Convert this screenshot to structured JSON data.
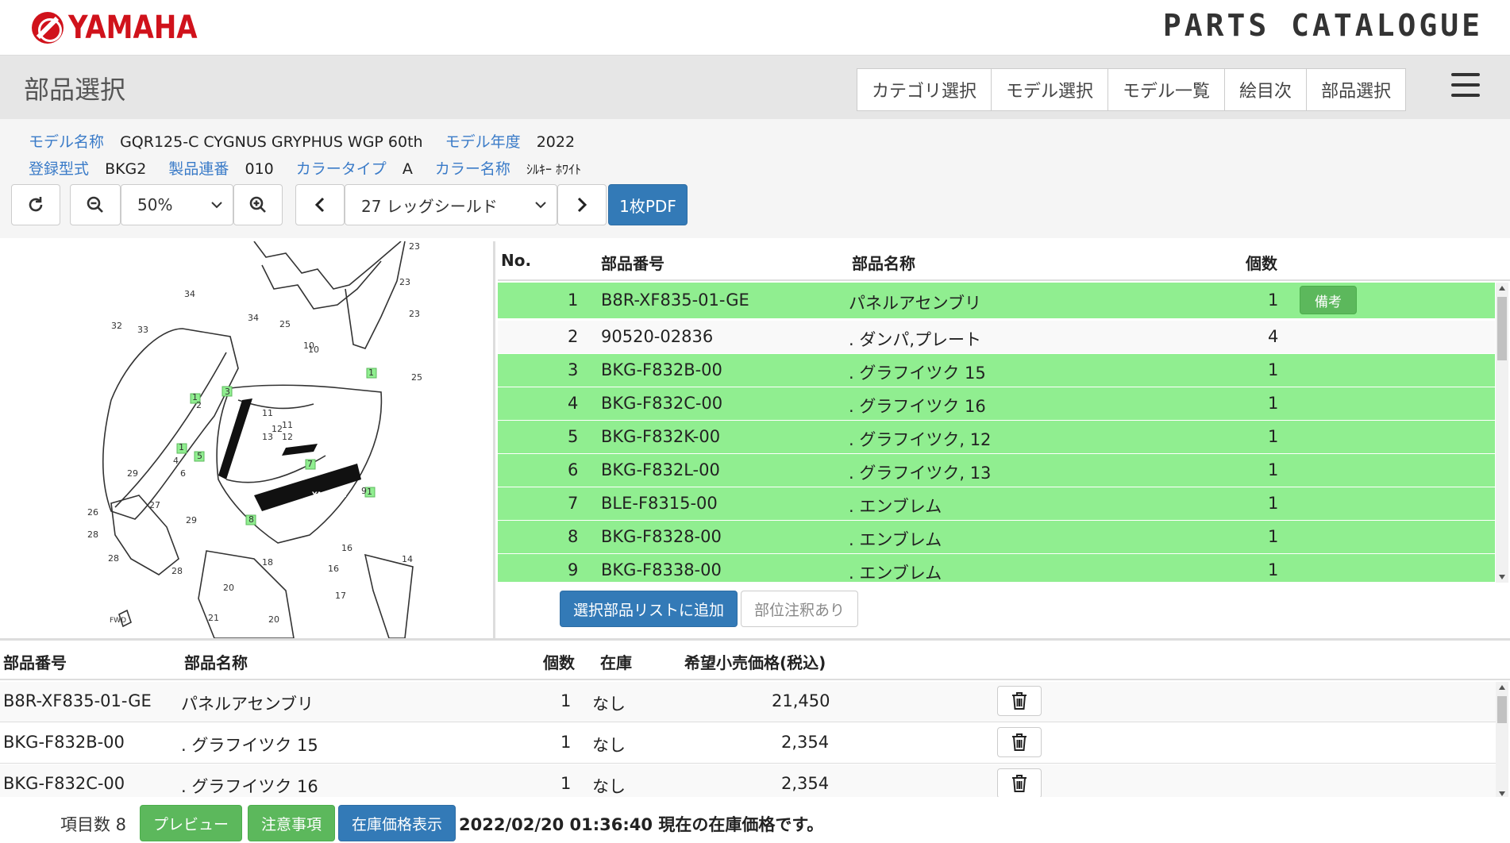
{
  "brand": {
    "logo_text": "YAMAHA",
    "catalogue_text": "PARTS CATALOGUE"
  },
  "header": {
    "title": "部品選択",
    "tabs": [
      "カテゴリ選択",
      "モデル選択",
      "モデル一覧",
      "絵目次",
      "部品選択"
    ]
  },
  "info": {
    "model_name_label": "モデル名称",
    "model_name": "GQR125-C CYGNUS GRYPHUS WGP 60th",
    "model_year_label": "モデル年度",
    "model_year": "2022",
    "reg_type_label": "登録型式",
    "reg_type": "BKG2",
    "serial_label": "製品連番",
    "serial": "010",
    "color_type_label": "カラータイプ",
    "color_type": "A",
    "color_name_label": "カラー名称",
    "color_name": "ｼﾙｷｰ ﾎﾜｲﾄ"
  },
  "toolbar": {
    "zoom_value": "50%",
    "page_select": "27 レッグシールド",
    "pdf_label": "1枚PDF"
  },
  "parts_table": {
    "headers": {
      "no": "No.",
      "part_number": "部品番号",
      "part_name": "部品名称",
      "qty": "個数"
    },
    "rows": [
      {
        "no": "1",
        "part_number": "B8R-XF835-01-GE",
        "part_name": "パネルアセンブリ",
        "qty": "1",
        "note": "備考"
      },
      {
        "no": "2",
        "part_number": "90520-02836",
        "part_name": ". ダンパ,プレート",
        "qty": "4"
      },
      {
        "no": "3",
        "part_number": "BKG-F832B-00",
        "part_name": ". グラフイツク 15",
        "qty": "1"
      },
      {
        "no": "4",
        "part_number": "BKG-F832C-00",
        "part_name": ". グラフイツク 16",
        "qty": "1"
      },
      {
        "no": "5",
        "part_number": "BKG-F832K-00",
        "part_name": ". グラフイツク, 12",
        "qty": "1"
      },
      {
        "no": "6",
        "part_number": "BKG-F832L-00",
        "part_name": ". グラフイツク, 13",
        "qty": "1"
      },
      {
        "no": "7",
        "part_number": "BLE-F8315-00",
        "part_name": ". エンブレム",
        "qty": "1"
      },
      {
        "no": "8",
        "part_number": "BKG-F8328-00",
        "part_name": ". エンブレム",
        "qty": "1"
      },
      {
        "no": "9",
        "part_number": "BKG-F8338-00",
        "part_name": ". エンブレム",
        "qty": "1"
      }
    ],
    "add_button": "選択部品リストに追加",
    "annotation_button": "部位注釈あり"
  },
  "selected_list": {
    "headers": {
      "part_number": "部品番号",
      "part_name": "部品名称",
      "qty": "個数",
      "stock": "在庫",
      "price": "希望小売価格(税込)"
    },
    "rows": [
      {
        "part_number": "B8R-XF835-01-GE",
        "part_name": "パネルアセンブリ",
        "qty": "1",
        "stock": "なし",
        "price": "21,450"
      },
      {
        "part_number": "BKG-F832B-00",
        "part_name": ". グラフイツク 15",
        "qty": "1",
        "stock": "なし",
        "price": "2,354"
      },
      {
        "part_number": "BKG-F832C-00",
        "part_name": ". グラフイツク 16",
        "qty": "1",
        "stock": "なし",
        "price": "2,354"
      }
    ]
  },
  "footer": {
    "count_label": "項目数 8",
    "preview_button": "プレビュー",
    "notice_button": "注意事項",
    "stock_button": "在庫価格表示",
    "status_message": "2022/02/20 01:36:40 現在の在庫価格です。"
  },
  "diagram_labels": [
    "23",
    "23",
    "23",
    "25",
    "34",
    "34",
    "32",
    "33",
    "25",
    "10",
    "1",
    "1",
    "1",
    "1",
    "11",
    "12",
    "13",
    "11",
    "12",
    "10",
    "29",
    "27",
    "26",
    "28",
    "28",
    "28",
    "29",
    "18",
    "20",
    "21",
    "20",
    "16",
    "16",
    "17",
    "14",
    "2",
    "3",
    "4",
    "5",
    "6",
    "7",
    "8",
    "9"
  ],
  "diagram_emblem": "YAMAHA",
  "diagram_direction": "FWD",
  "colors": {
    "row_green": "#90ee90",
    "blue_button": "#337ab7",
    "green_button": "#5cb85c",
    "label_blue": "#3a7bc8",
    "brand_red": "#d0121b"
  }
}
